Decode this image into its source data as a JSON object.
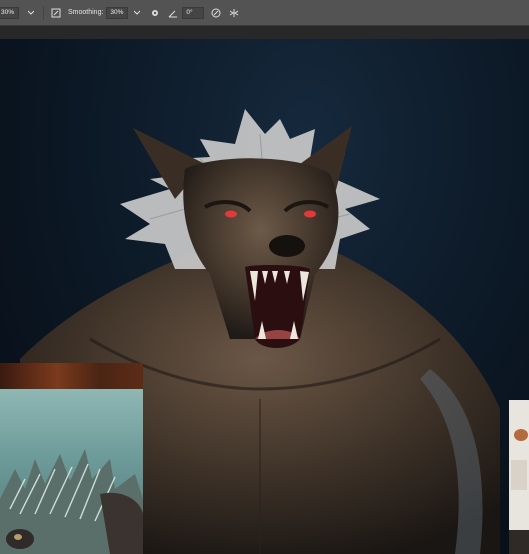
{
  "options_bar": {
    "opacity_value": "30%",
    "flow_icon": "airbrush-pressure-icon",
    "smoothing_label": "Smoothing:",
    "smoothing_value": "30%",
    "settings_icon": "gear-icon",
    "angle_icon": "angle-icon",
    "angle_value": "0°",
    "pressure_icon": "pen-pressure-icon",
    "symmetry_icon": "symmetry-icon"
  },
  "colors": {
    "toolbar_bg": "#535353",
    "canvas_bg": "#0d1a28",
    "fur": "#c9c9c9",
    "skin": "#4a3a2d",
    "eyes": "#e03a3a"
  }
}
